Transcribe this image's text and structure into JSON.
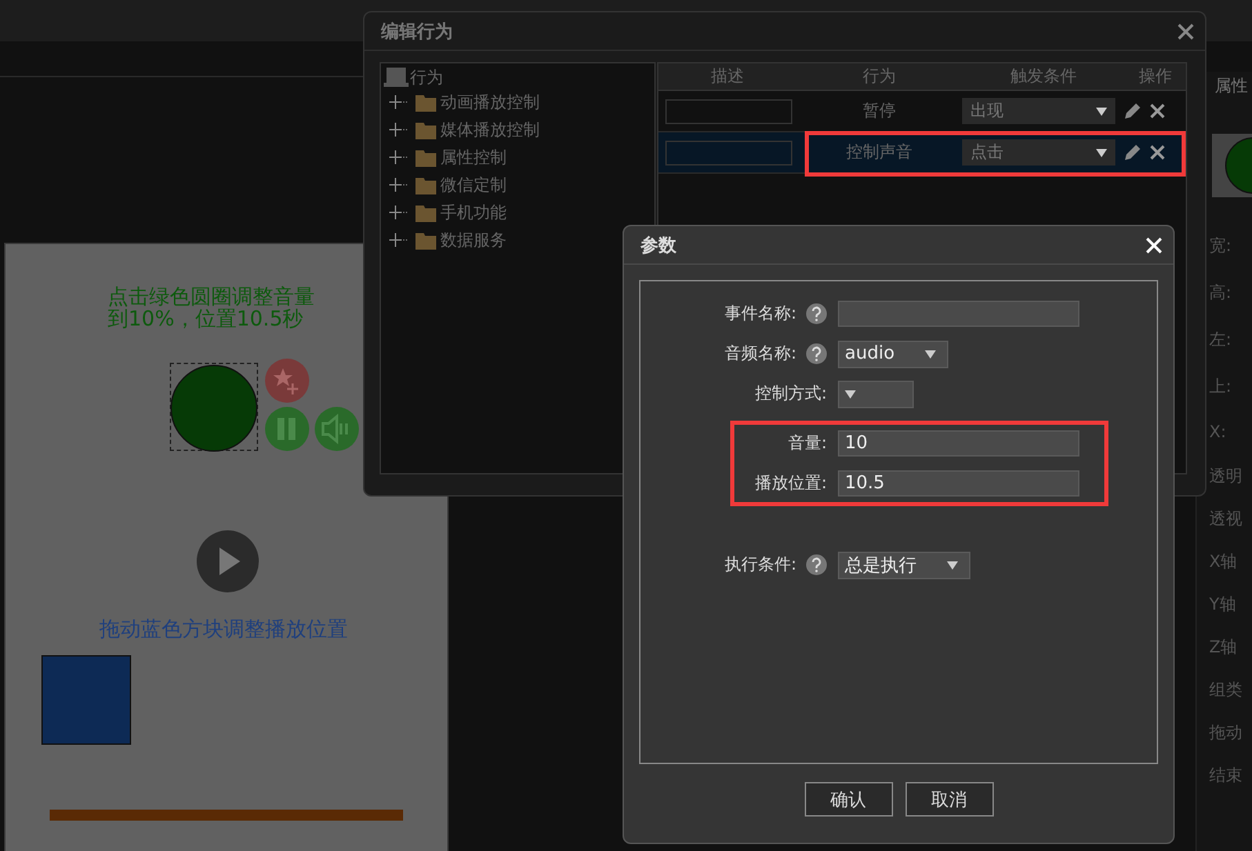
{
  "canvas": {
    "instruction": "点击绿色圆圈调整音量到10%，位置10.5秒",
    "drag_hint": "拖动蓝色方块调整播放位置"
  },
  "properties_panel": {
    "tab": "属性",
    "labels": [
      "宽:",
      "高:",
      "左:",
      "上:",
      "X:",
      "透明",
      "透视",
      "X轴",
      "Y轴",
      "Z轴",
      "组类",
      "拖动",
      "结束"
    ]
  },
  "edit_dialog": {
    "title": "编辑行为",
    "tree": {
      "label": "行为",
      "children": [
        {
          "label": "动画播放控制",
          "expanded": false
        },
        {
          "label": "媒体播放控制",
          "expanded": false
        },
        {
          "label": "属性控制",
          "expanded": false
        },
        {
          "label": "微信定制",
          "expanded": false
        },
        {
          "label": "手机功能",
          "expanded": false
        },
        {
          "label": "数据服务",
          "expanded": false
        }
      ]
    },
    "table": {
      "columns": [
        "描述",
        "行为",
        "触发条件",
        "操作"
      ],
      "rows": [
        {
          "action": "暂停",
          "trigger": "出现",
          "selected": false,
          "highlighted": false
        },
        {
          "action": "控制声音",
          "trigger": "点击",
          "selected": true,
          "highlighted": true
        }
      ]
    }
  },
  "params_dialog": {
    "title": "参数",
    "sections": [
      {
        "highlighted": false,
        "fields": [
          {
            "label": "事件名称:",
            "help": true,
            "kind": "text"
          },
          {
            "label": "音频名称:",
            "help": true,
            "kind": "select",
            "value": "audio"
          },
          {
            "label": "控制方式:",
            "help": false,
            "kind": "select"
          }
        ]
      },
      {
        "highlighted": true,
        "fields": [
          {
            "label": "音量:",
            "help": false,
            "kind": "text",
            "value": "10"
          },
          {
            "label": "播放位置:",
            "help": false,
            "kind": "text",
            "value": "10.5"
          }
        ]
      },
      {
        "highlighted": false,
        "fields": [
          {
            "label": "执行条件:",
            "help": true,
            "kind": "select",
            "value": "总是执行"
          }
        ]
      }
    ],
    "buttons": [
      "确认",
      "取消"
    ]
  }
}
